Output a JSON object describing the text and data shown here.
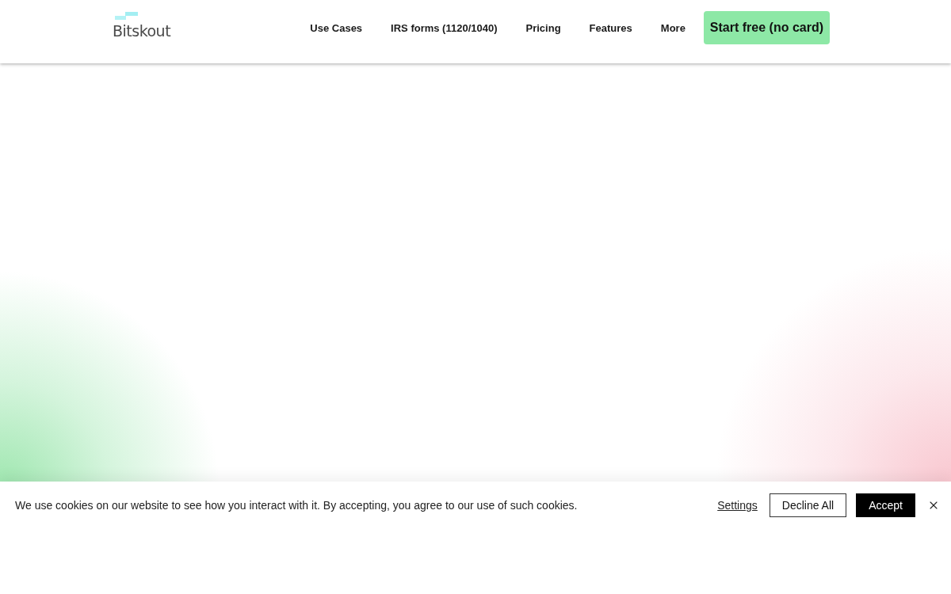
{
  "header": {
    "logo": "Bitskout",
    "nav": [
      "Use Cases",
      "IRS forms (1120/1040)",
      "Pricing",
      "Features",
      "More"
    ],
    "cta": "Start free (no card)"
  },
  "cookie_banner": {
    "message": "We use cookies on our website to see how you interact with it. By accepting, you agree to our use of such cookies.",
    "settings_link": "Settings",
    "buttons": [
      {
        "label": "Decline All",
        "kind": "outline"
      },
      {
        "label": "Accept",
        "kind": "solid"
      }
    ]
  }
}
